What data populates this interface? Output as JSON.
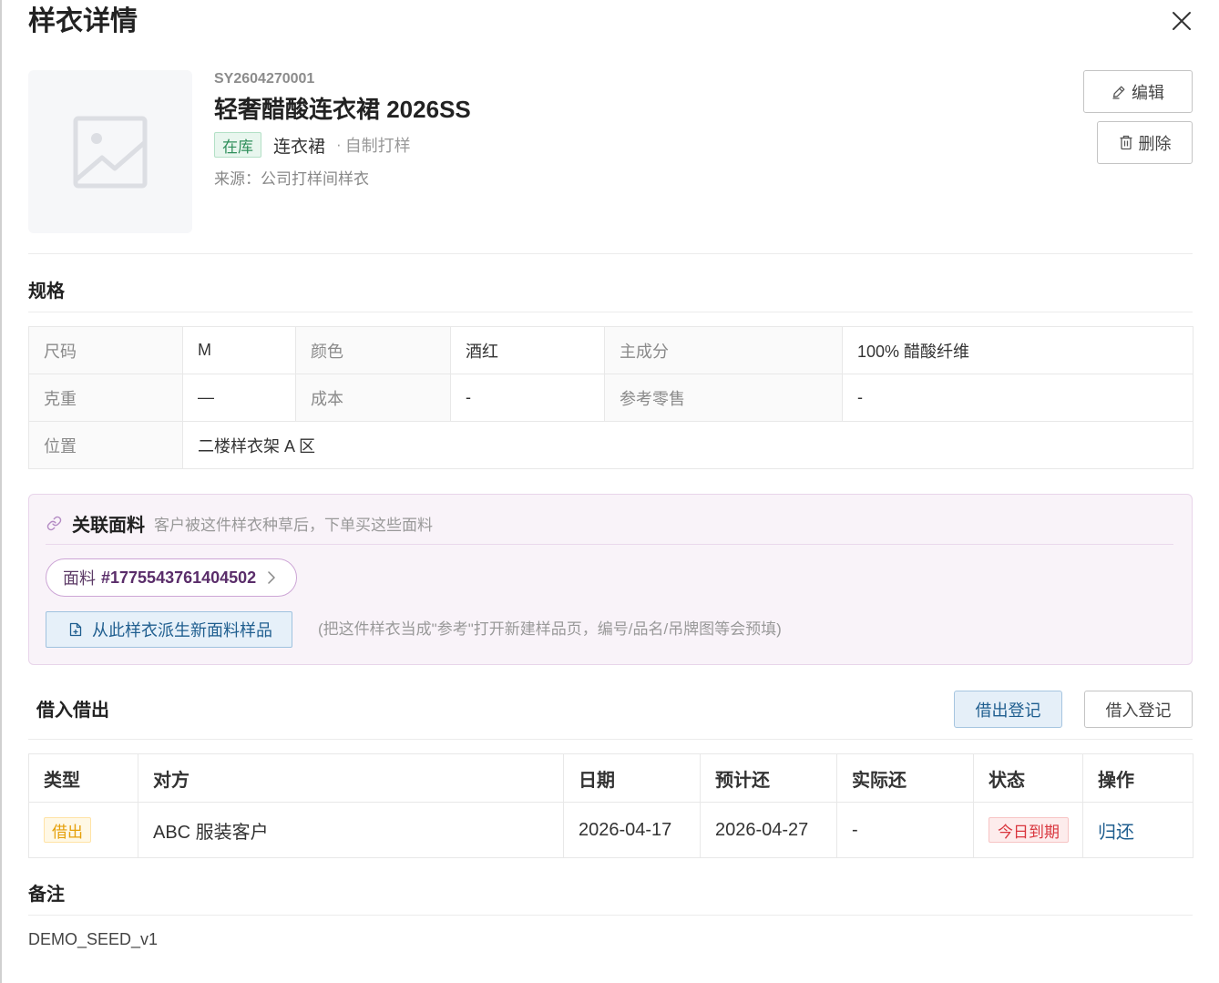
{
  "colors": {
    "text_primary": "#222222",
    "border": "#ececec",
    "primary_blue": "#1f5e8f",
    "in_stock_green": "#2f8f5b",
    "fabric_purple": "#5a2d6a",
    "fabric_panel_bg": "#f9f3f9",
    "lend_orange": "#e5a00b",
    "due_red": "#d9363e"
  },
  "drawer": {
    "title": "样衣详情",
    "close_icon": "close-icon"
  },
  "sample": {
    "image_icon": "image-placeholder-icon",
    "code": "SY2604270001",
    "name": "轻奢醋酸连衣裙 2026SS",
    "status_tag": "在库",
    "category": "连衣裙",
    "origin_separator": "·",
    "origin": "自制打样",
    "source": "来源：公司打样间样衣"
  },
  "actions": {
    "edit": {
      "label": "编辑",
      "icon": "pencil-icon"
    },
    "delete": {
      "label": "删除",
      "icon": "trash-icon"
    }
  },
  "specs": {
    "title": "规格",
    "rows": [
      [
        {
          "label": "尺码",
          "value": "M"
        },
        {
          "label": "颜色",
          "value": "酒红"
        },
        {
          "label": "主成分",
          "value": "100% 醋酸纤维"
        }
      ],
      [
        {
          "label": "克重",
          "value": "—"
        },
        {
          "label": "成本",
          "value": "-"
        },
        {
          "label": "参考零售",
          "value": "-"
        }
      ],
      [
        {
          "label": "位置",
          "value": "二楼样衣架 A 区"
        }
      ]
    ]
  },
  "linked_fabric": {
    "icon": "link-icon",
    "title": "关联面料",
    "hint": "客户被这件样衣种草后，下单买这些面料",
    "items": [
      {
        "prefix": "面料",
        "code": "#1775543761404502",
        "icon": "chevron-right-icon"
      }
    ],
    "derive_button": {
      "label": "从此样衣派生新面料样品",
      "icon": "file-plus-icon"
    },
    "derive_note": "(把这件样衣当成\"参考\"打开新建样品页，编号/品名/吊牌图等会预填)"
  },
  "loans": {
    "title": "借入借出",
    "lend_button": "借出登记",
    "borrow_button": "借入登记",
    "columns": [
      "类型",
      "对方",
      "日期",
      "预计还",
      "实际还",
      "状态",
      "操作"
    ],
    "rows": [
      {
        "type": "借出",
        "party": "ABC 服装客户",
        "date": "2026-04-17",
        "expected_return": "2026-04-27",
        "actual_return": "-",
        "status": "今日到期",
        "action": "归还"
      }
    ]
  },
  "notes": {
    "title": "备注",
    "content": "DEMO_SEED_v1"
  }
}
